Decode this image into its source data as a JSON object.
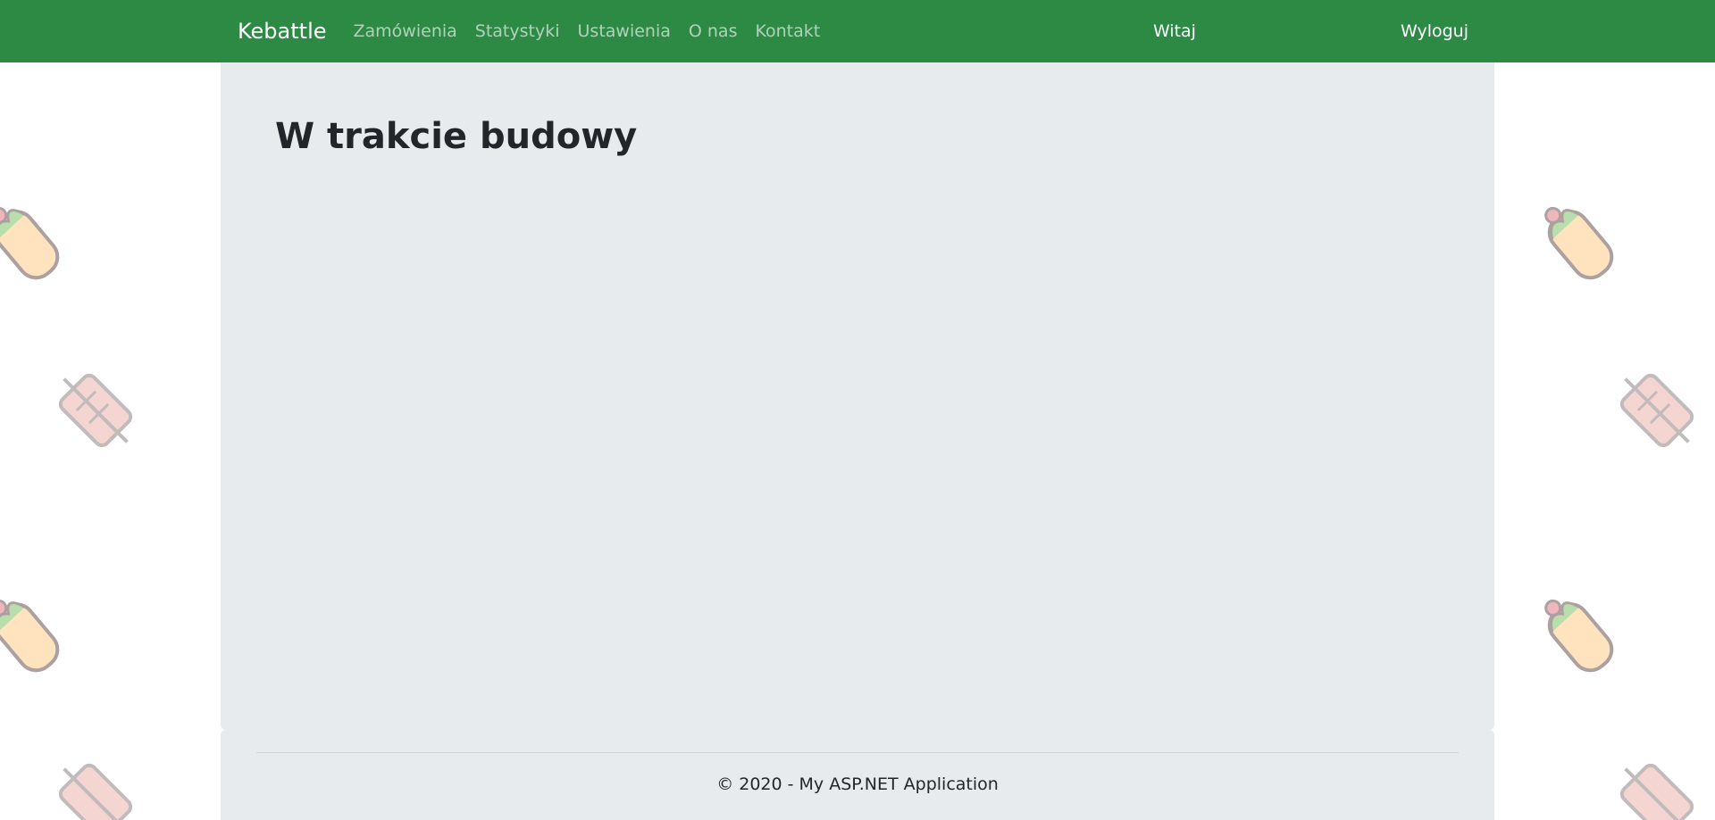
{
  "navbar": {
    "brand": "Kebattle",
    "links": [
      "Zamówienia",
      "Statystyki",
      "Ustawienia",
      "O nas",
      "Kontakt"
    ],
    "greeting": "Witaj",
    "logout": "Wyloguj",
    "background_color": "#2d8a45"
  },
  "main": {
    "title": "W trakcie budowy",
    "background_color": "#e7ebee"
  },
  "footer": {
    "text": "© 2020 - My ASP.NET Application"
  },
  "background": {
    "pattern_icons": [
      "kebab-skewer-icon",
      "wrap-icon"
    ]
  }
}
